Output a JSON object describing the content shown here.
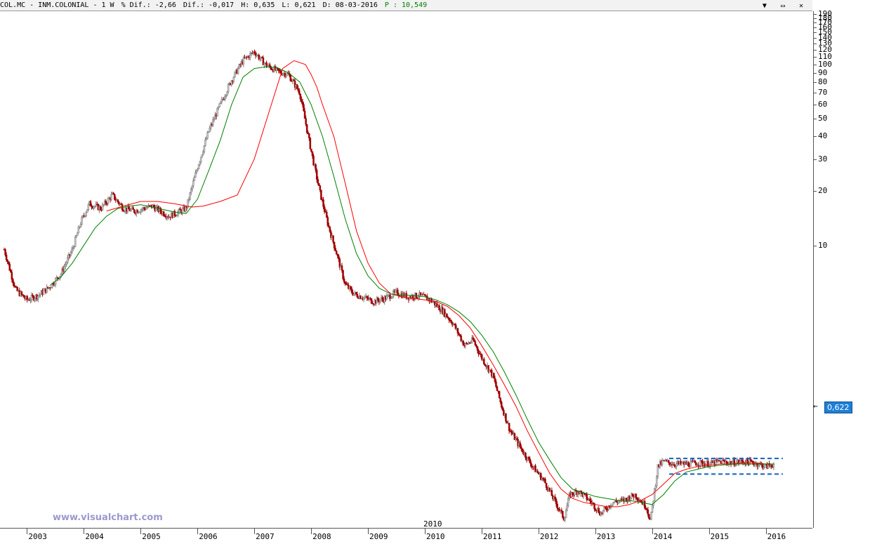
{
  "header": {
    "symbol": "COL.MC - INM.COLONIAL -  1 W",
    "dif_pct": "% Dif.: -2,66",
    "dif": "Dif.: -0,017",
    "high": "H: 0,635",
    "low": "L: 0,621",
    "date": "D: 08-03-2016",
    "p": "P : 10,549"
  },
  "window_buttons": [
    "▼",
    "▭",
    "✕"
  ],
  "watermark": "www.visualchart.com",
  "current_price": "0,622",
  "year_marker_2010": "2010",
  "colors": {
    "sma_fast": "#008000",
    "sma_slow": "#ff0000",
    "bull": "#999999",
    "bear": "#a00000",
    "guide": "#1060c0",
    "tag": "#1e7fd6"
  },
  "chart_data": {
    "type": "line",
    "title": "",
    "scale": "log",
    "ylim": [
      0.28,
      190
    ],
    "y_ticks": [
      190,
      180,
      170,
      160,
      150,
      140,
      130,
      120,
      110,
      100,
      90,
      80,
      70,
      60,
      50,
      40,
      30,
      20,
      10
    ],
    "x_ticks": [
      "2003",
      "2004",
      "2005",
      "2006",
      "2007",
      "2008",
      "2009",
      "2010",
      "2011",
      "2012",
      "2013",
      "2014",
      "2015",
      "2016"
    ],
    "x_range": [
      2002.6,
      2016.4
    ],
    "series": [
      {
        "role": "price",
        "x": [
          2002.6,
          2002.8,
          2003.0,
          2003.2,
          2003.4,
          2003.6,
          2003.8,
          2003.95,
          2004.1,
          2004.3,
          2004.5,
          2004.7,
          2004.9,
          2005.2,
          2005.5,
          2005.8,
          2006.0,
          2006.2,
          2006.4,
          2006.6,
          2006.8,
          2007.0,
          2007.1,
          2007.2,
          2007.4,
          2007.6,
          2007.8,
          2007.95,
          2008.05,
          2008.15,
          2008.3,
          2008.45,
          2008.6,
          2008.75,
          2008.9,
          2009.1,
          2009.3,
          2009.5,
          2009.7,
          2009.9,
          2010.1,
          2010.3,
          2010.5,
          2010.7,
          2010.85,
          2011.0,
          2011.2,
          2011.35,
          2011.5,
          2011.7,
          2011.9,
          2012.1,
          2012.3,
          2012.45,
          2012.55,
          2012.7,
          2012.9,
          2013.1,
          2013.3,
          2013.5,
          2013.7,
          2013.9,
          2013.97,
          2014.1,
          2014.2,
          2014.4,
          2014.6,
          2014.8,
          2015.0,
          2015.2,
          2015.4,
          2015.6,
          2015.8,
          2016.0,
          2016.15
        ],
        "values": [
          9.5,
          5.7,
          5.0,
          5.3,
          5.9,
          7.0,
          9.5,
          13.5,
          17.0,
          16.0,
          19.0,
          16.0,
          15.5,
          16.5,
          14.5,
          16.0,
          27.0,
          43.0,
          60.0,
          82.0,
          105.0,
          118.0,
          108.0,
          100.0,
          92.0,
          88.0,
          70.0,
          40.0,
          28.0,
          20.0,
          13.0,
          9.0,
          6.1,
          5.4,
          5.2,
          4.9,
          5.1,
          5.5,
          5.2,
          5.3,
          5.0,
          4.4,
          3.7,
          2.8,
          3.0,
          2.4,
          1.9,
          1.3,
          0.95,
          0.75,
          0.6,
          0.5,
          0.38,
          0.31,
          0.42,
          0.44,
          0.39,
          0.33,
          0.38,
          0.39,
          0.42,
          0.36,
          0.3,
          0.6,
          0.64,
          0.62,
          0.62,
          0.63,
          0.62,
          0.64,
          0.63,
          0.64,
          0.63,
          0.6,
          0.622
        ]
      },
      {
        "role": "fast-ma",
        "x": [
          2003.4,
          2003.6,
          2003.8,
          2004.0,
          2004.2,
          2004.4,
          2004.6,
          2004.8,
          2005.0,
          2005.2,
          2005.4,
          2005.6,
          2005.8,
          2006.0,
          2006.2,
          2006.4,
          2006.6,
          2006.8,
          2007.0,
          2007.2,
          2007.4,
          2007.6,
          2007.8,
          2008.0,
          2008.2,
          2008.4,
          2008.6,
          2008.8,
          2009.0,
          2009.2,
          2009.4,
          2009.6,
          2009.8,
          2010.0,
          2010.2,
          2010.4,
          2010.6,
          2010.8,
          2011.0,
          2011.2,
          2011.4,
          2011.6,
          2011.8,
          2012.0,
          2012.2,
          2012.4,
          2012.6,
          2012.8,
          2013.0,
          2013.2,
          2013.4,
          2013.6,
          2013.8,
          2014.0,
          2014.2,
          2014.4,
          2014.6,
          2014.8,
          2015.0,
          2015.2,
          2015.4,
          2015.6,
          2015.8,
          2016.0,
          2016.15
        ],
        "values": [
          6.0,
          6.7,
          8.0,
          10.0,
          12.5,
          14.5,
          16.0,
          16.5,
          16.8,
          16.3,
          15.8,
          15.3,
          15.0,
          18.0,
          26.0,
          38.0,
          60.0,
          85.0,
          95.0,
          97.0,
          96.0,
          90.0,
          80.0,
          60.0,
          40.0,
          24.0,
          14.0,
          9.0,
          6.8,
          5.8,
          5.4,
          5.3,
          5.3,
          5.2,
          5.0,
          4.7,
          4.3,
          3.8,
          3.2,
          2.6,
          2.0,
          1.5,
          1.1,
          0.82,
          0.65,
          0.52,
          0.45,
          0.43,
          0.41,
          0.4,
          0.39,
          0.39,
          0.38,
          0.37,
          0.42,
          0.5,
          0.56,
          0.58,
          0.6,
          0.61,
          0.62,
          0.62,
          0.62,
          0.62,
          0.62
        ]
      },
      {
        "role": "slow-ma",
        "x": [
          2004.4,
          2004.7,
          2005.0,
          2005.3,
          2005.6,
          2005.9,
          2006.1,
          2006.4,
          2006.7,
          2007.0,
          2007.3,
          2007.5,
          2007.7,
          2007.9,
          2008.0,
          2008.1,
          2008.2,
          2008.4,
          2008.6,
          2008.8,
          2009.0,
          2009.2,
          2009.4,
          2009.6,
          2009.8,
          2010.0,
          2010.2,
          2010.4,
          2010.6,
          2010.8,
          2011.0,
          2011.2,
          2011.4,
          2011.6,
          2011.8,
          2012.0,
          2012.2,
          2012.4,
          2012.6,
          2012.8,
          2013.0,
          2013.2,
          2013.4,
          2013.6,
          2013.8,
          2014.0,
          2014.2,
          2014.4,
          2014.6,
          2014.8,
          2015.0,
          2015.2,
          2015.4,
          2015.6,
          2015.8,
          2016.0,
          2016.15
        ],
        "values": [
          15.5,
          16.5,
          17.5,
          17.5,
          17.0,
          16.3,
          16.5,
          17.5,
          19.0,
          30.0,
          60.0,
          95.0,
          105.0,
          100.0,
          88.0,
          75.0,
          60.0,
          40.0,
          22.0,
          12.0,
          8.0,
          6.2,
          5.4,
          5.2,
          5.1,
          5.0,
          4.9,
          4.6,
          4.1,
          3.5,
          2.8,
          2.2,
          1.7,
          1.3,
          0.95,
          0.72,
          0.55,
          0.45,
          0.4,
          0.38,
          0.37,
          0.36,
          0.36,
          0.37,
          0.39,
          0.42,
          0.48,
          0.55,
          0.58,
          0.6,
          0.61,
          0.62,
          0.62,
          0.63,
          0.63,
          0.62,
          0.62
        ]
      }
    ],
    "guides": [
      {
        "from": 2014.3,
        "to": 2016.3,
        "value": 0.665
      },
      {
        "from": 2014.3,
        "to": 2016.3,
        "value": 0.545
      }
    ]
  }
}
